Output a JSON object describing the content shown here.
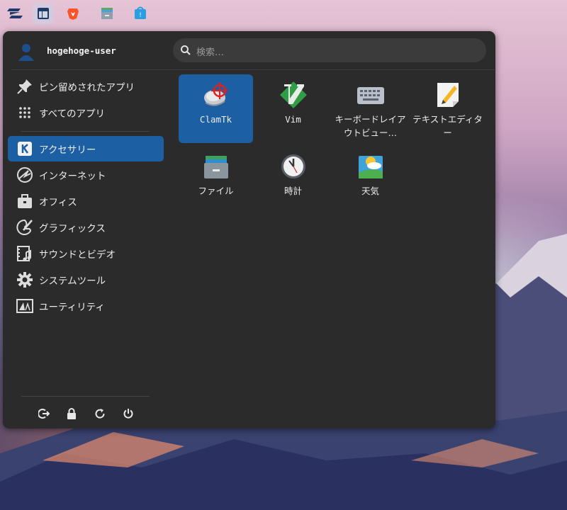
{
  "taskbar": {
    "items": [
      {
        "icon": "zorin-logo-icon"
      },
      {
        "icon": "app-menu-icon",
        "active": true
      },
      {
        "icon": "brave-browser-icon"
      },
      {
        "icon": "file-manager-icon"
      },
      {
        "icon": "software-store-icon"
      }
    ]
  },
  "menu": {
    "user": {
      "name": "hogehoge-user",
      "avatar_icon": "user-avatar-icon"
    },
    "search": {
      "placeholder": "検索…",
      "icon": "search-icon"
    },
    "sidebar": {
      "top_items": [
        {
          "label": "ピン留めされたアプリ",
          "icon": "pin-icon"
        },
        {
          "label": "すべてのアプリ",
          "icon": "grid-icon"
        }
      ],
      "categories": [
        {
          "label": "アクセサリー",
          "icon": "accessories-icon",
          "selected": true
        },
        {
          "label": "インターネット",
          "icon": "internet-icon"
        },
        {
          "label": "オフィス",
          "icon": "office-icon"
        },
        {
          "label": "グラフィックス",
          "icon": "graphics-icon"
        },
        {
          "label": "サウンドとビデオ",
          "icon": "sound-video-icon"
        },
        {
          "label": "システムツール",
          "icon": "system-tools-icon"
        },
        {
          "label": "ユーティリティ",
          "icon": "utilities-icon"
        }
      ],
      "footer_buttons": [
        {
          "icon": "log-out-icon"
        },
        {
          "icon": "lock-icon"
        },
        {
          "icon": "restart-icon"
        },
        {
          "icon": "power-icon"
        }
      ]
    },
    "apps": [
      {
        "label": "ClamTk",
        "icon": "clamtk-icon",
        "selected": true
      },
      {
        "label": "Vim",
        "icon": "vim-icon"
      },
      {
        "label": "キーボードレイアウトビュー…",
        "icon": "keyboard-icon"
      },
      {
        "label": "テキストエディター",
        "icon": "text-editor-icon"
      },
      {
        "label": "ファイル",
        "icon": "files-icon"
      },
      {
        "label": "時計",
        "icon": "clock-icon"
      },
      {
        "label": "天気",
        "icon": "weather-icon"
      }
    ]
  },
  "colors": {
    "menu_bg": "#2b2b2b",
    "selection": "#1c5fa3",
    "search_bg": "#3b3b3b"
  }
}
